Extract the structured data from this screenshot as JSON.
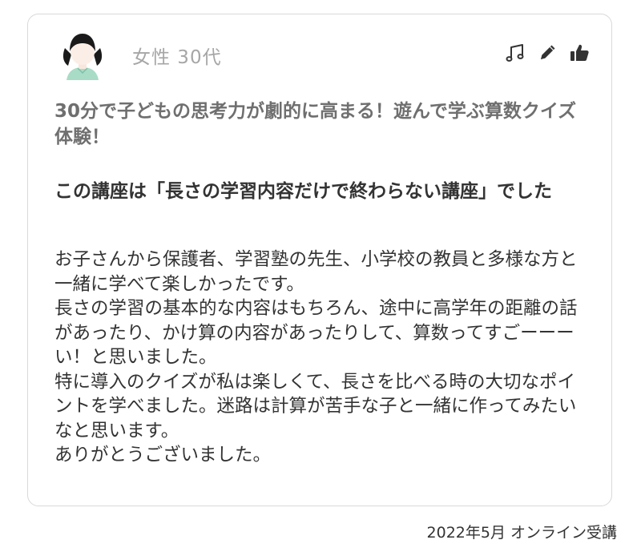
{
  "reviewer": {
    "avatar_icon": "female-avatar-icon",
    "label": "女性 30代"
  },
  "actions": [
    {
      "name": "music-note-icon"
    },
    {
      "name": "pencil-icon"
    },
    {
      "name": "thumbs-up-icon"
    }
  ],
  "review": {
    "title": "30分で子どもの思考力が劇的に高まる！遊んで学ぶ算数クイズ体験！",
    "subtitle": "この講座は「長さの学習内容だけで終わらない講座」でした",
    "body": "お子さんから保護者、学習塾の先生、小学校の教員と多様な方と一緒に学べて楽しかったです。\n長さの学習の基本的な内容はもちろん、途中に高学年の距離の話があったり、かけ算の内容があったりして、算数ってすごーーーい！と思いました。\n特に導入のクイズが私は楽しくて、長さを比べる時の大切なポイントを学べました。迷路は計算が苦手な子と一緒に作ってみたいなと思います。\nありがとうございました。"
  },
  "footer": {
    "meta": "2022年5月 オンライン受講"
  }
}
